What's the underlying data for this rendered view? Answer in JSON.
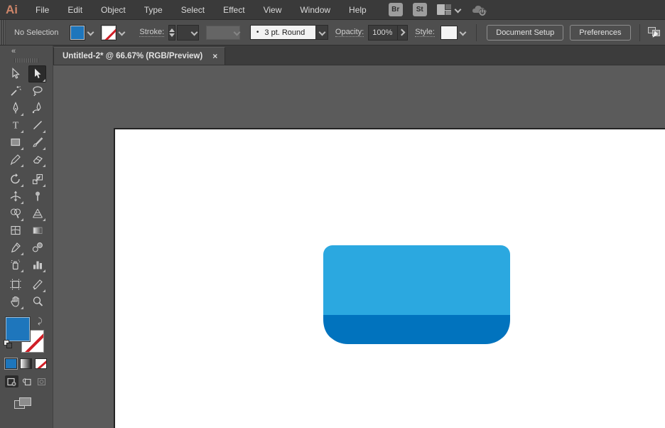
{
  "menubar": {
    "logo": "Ai",
    "items": [
      "File",
      "Edit",
      "Object",
      "Type",
      "Select",
      "Effect",
      "View",
      "Window",
      "Help"
    ],
    "bridge_label": "Br",
    "stock_label": "St"
  },
  "controlbar": {
    "no_selection": "No Selection",
    "stroke_label": "Stroke:",
    "brush_bullet": "•",
    "brush_value": "3 pt. Round",
    "opacity_label": "Opacity:",
    "opacity_value": "100%",
    "style_label": "Style:",
    "document_setup_label": "Document Setup",
    "preferences_label": "Preferences"
  },
  "tabbar": {
    "tab_title": "Untitled-2* @ 66.67% (RGB/Preview)",
    "close_glyph": "×",
    "document_name": "Untitled-2*",
    "zoom_level": "66.67%",
    "color_mode": "RGB/Preview"
  },
  "toolbar": {
    "collapse_glyph": "«",
    "active_tool": "direct-selection-tool",
    "tools": [
      "selection-tool",
      "direct-selection-tool",
      "magic-wand-tool",
      "lasso-tool",
      "pen-tool",
      "curvature-tool",
      "type-tool",
      "line-segment-tool",
      "rectangle-tool",
      "paintbrush-tool",
      "shaper-tool",
      "eraser-tool",
      "rotate-tool",
      "scale-tool",
      "width-tool",
      "puppet-warp-tool",
      "shape-builder-tool",
      "perspective-grid-tool",
      "mesh-tool",
      "gradient-tool",
      "eyedropper-tool",
      "blend-tool",
      "symbol-sprayer-tool",
      "column-graph-tool",
      "artboard-tool",
      "slice-tool",
      "hand-tool",
      "zoom-tool"
    ]
  },
  "colors": {
    "fill_swatch_blue": "#1e76bc",
    "shape_top_blue": "#2ba8e0",
    "shape_bottom_blue": "#0173be",
    "stroke_none_red": "#d01f27",
    "logo_orange": "#cd8569",
    "ui_dark": "#3a3a3a",
    "ui_mid": "#4e4e4e",
    "pasteboard": "#5b5b5b",
    "artboard": "#ffffff"
  },
  "artwork": {
    "description": "rounded container shape, light blue top and dark blue bottom",
    "top_color": "#2ba8e0",
    "bottom_color": "#0173be"
  }
}
